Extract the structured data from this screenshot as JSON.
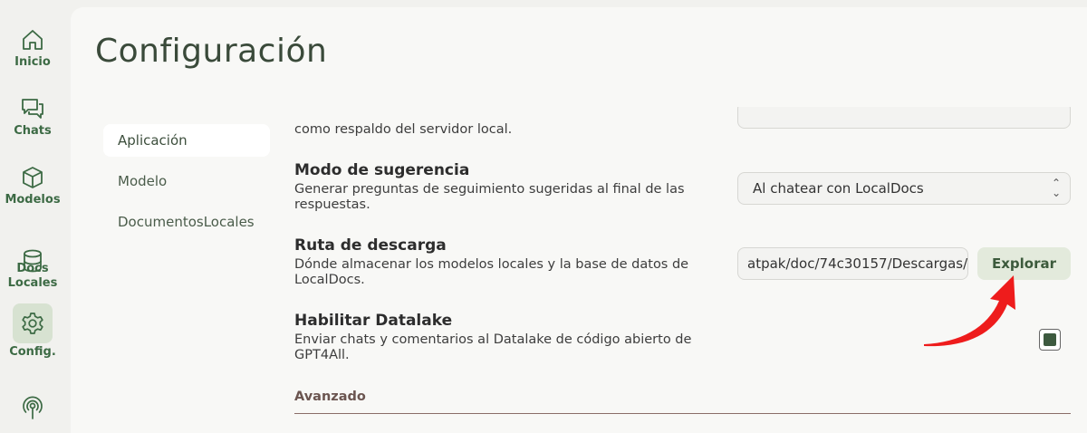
{
  "nav": {
    "items": [
      {
        "label": "Inicio"
      },
      {
        "label": "Chats"
      },
      {
        "label": "Modelos"
      },
      {
        "label": "Docs\nLocales"
      },
      {
        "label": "Config."
      }
    ]
  },
  "page": {
    "title": "Configuración"
  },
  "subnav": {
    "items": [
      {
        "label": "Aplicación"
      },
      {
        "label": "Modelo"
      },
      {
        "label": "DocumentosLocales"
      }
    ]
  },
  "settings": {
    "partial_desc": "como respaldo del servidor local.",
    "suggestion": {
      "title": "Modo de sugerencia",
      "desc": "Generar preguntas de seguimiento sugeridas al final de las respuestas.",
      "value": "Al chatear con LocalDocs"
    },
    "download": {
      "title": "Ruta de descarga",
      "desc": "Dónde almacenar los modelos locales y la base de datos de LocalDocs.",
      "value": "atpak/doc/74c30157/Descargas/",
      "browse_label": "Explorar"
    },
    "datalake": {
      "title": "Habilitar Datalake",
      "desc": "Enviar chats y comentarios al Datalake de código abierto de GPT4All.",
      "checked": true
    },
    "advanced_label": "Avanzado"
  },
  "colors": {
    "accent": "#3c6a44",
    "annotation_arrow": "#ee1c1c"
  }
}
